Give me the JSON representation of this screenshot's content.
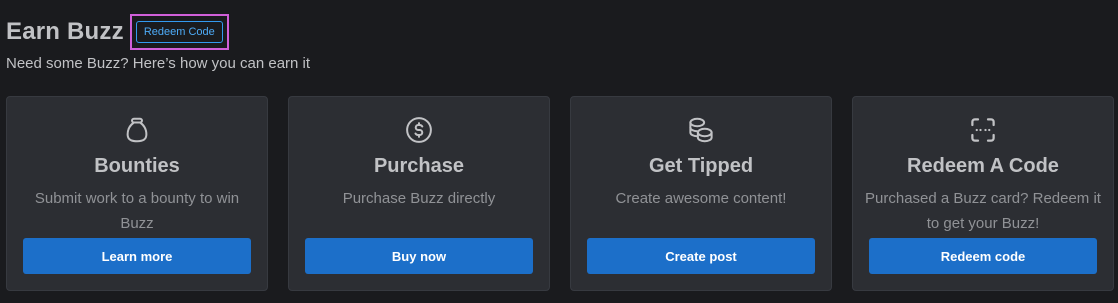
{
  "header": {
    "title": "Earn Buzz",
    "redeem_code_label": "Redeem Code",
    "subtitle": "Need some Buzz? Here’s how you can earn it"
  },
  "cards": [
    {
      "icon": "moneybag-icon",
      "title": "Bounties",
      "description": "Submit work to a bounty to win Buzz",
      "button": "Learn more"
    },
    {
      "icon": "coin-dollar-icon",
      "title": "Purchase",
      "description": "Purchase Buzz directly",
      "button": "Buy now"
    },
    {
      "icon": "coins-icon",
      "title": "Get Tipped",
      "description": "Create awesome content!",
      "button": "Create post"
    },
    {
      "icon": "scan-code-icon",
      "title": "Redeem A Code",
      "description": "Purchased a Buzz card? Redeem it to get your Buzz!",
      "button": "Redeem code"
    }
  ],
  "colors": {
    "background": "#1a1b1e",
    "card": "#2c2e33",
    "button": "#1c6fc9",
    "accent": "#339af0",
    "highlight": "#d05fd9"
  }
}
